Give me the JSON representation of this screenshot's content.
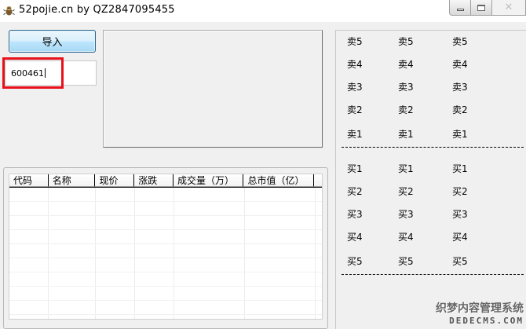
{
  "window": {
    "title": "52pojie.cn by QZ2847095455",
    "icon": "app-bug-icon",
    "minimize_icon": "minimize-icon",
    "maximize_icon": "maximize-icon",
    "close_glyph": "✕"
  },
  "toolbar": {
    "import_label": "导入"
  },
  "stock_code": {
    "value": "600461",
    "highlight_color": "#e8101a"
  },
  "grid": {
    "columns": [
      "代码",
      "名称",
      "现价",
      "涨跌",
      "成交量（万）",
      "总市值（亿）"
    ],
    "rows": []
  },
  "quotes": {
    "sell": [
      [
        "卖5",
        "卖5",
        "卖5"
      ],
      [
        "卖4",
        "卖4",
        "卖4"
      ],
      [
        "卖3",
        "卖3",
        "卖3"
      ],
      [
        "卖2",
        "卖2",
        "卖2"
      ],
      [
        "卖1",
        "卖1",
        "卖1"
      ]
    ],
    "buy": [
      [
        "买1",
        "买1",
        "买1"
      ],
      [
        "买2",
        "买2",
        "买2"
      ],
      [
        "买3",
        "买3",
        "买3"
      ],
      [
        "买4",
        "买4",
        "买4"
      ],
      [
        "买5",
        "买5",
        "买5"
      ]
    ]
  },
  "watermark": {
    "cn": "织梦内容管理系统",
    "en": "DEDECMS.COM"
  }
}
